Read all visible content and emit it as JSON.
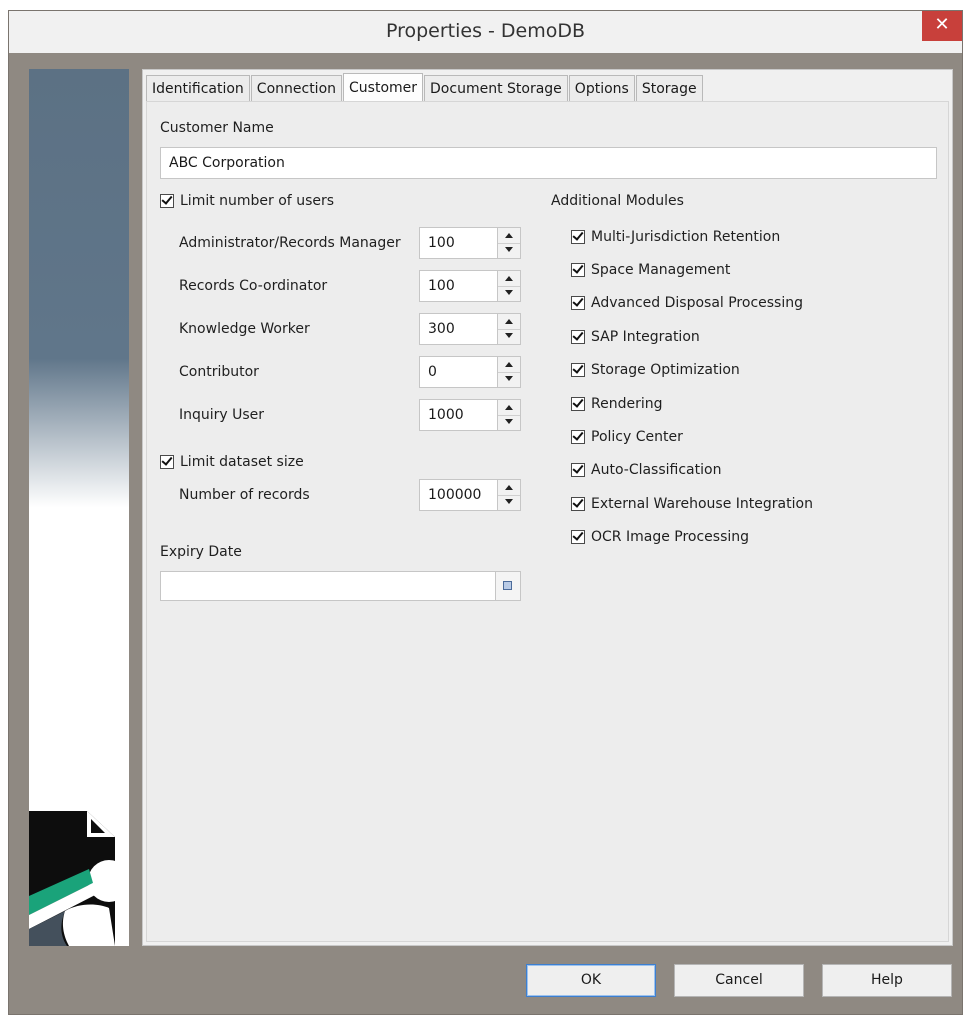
{
  "window": {
    "title": "Properties - DemoDB",
    "close_symbol": "✕"
  },
  "tabs": [
    {
      "label": "Identification"
    },
    {
      "label": "Connection"
    },
    {
      "label": "Customer",
      "active": true
    },
    {
      "label": "Document Storage"
    },
    {
      "label": "Options"
    },
    {
      "label": "Storage"
    }
  ],
  "customer": {
    "name_label": "Customer Name",
    "name_value": "ABC Corporation",
    "limit_users": {
      "label": "Limit number of users",
      "checked": true
    },
    "user_types": [
      {
        "label": "Administrator/Records Manager",
        "value": "100"
      },
      {
        "label": "Records Co-ordinator",
        "value": "100"
      },
      {
        "label": "Knowledge Worker",
        "value": "300"
      },
      {
        "label": "Contributor",
        "value": "0"
      },
      {
        "label": "Inquiry User",
        "value": "1000"
      }
    ],
    "limit_dataset": {
      "label": "Limit dataset size",
      "checked": true
    },
    "records": {
      "label": "Number of records",
      "value": "100000"
    },
    "expiry": {
      "label": "Expiry Date",
      "value": ""
    }
  },
  "modules": {
    "label": "Additional Modules",
    "items": [
      {
        "label": "Multi-Jurisdiction Retention",
        "checked": true
      },
      {
        "label": "Space Management",
        "checked": true
      },
      {
        "label": "Advanced Disposal Processing",
        "checked": true
      },
      {
        "label": "SAP Integration",
        "checked": true
      },
      {
        "label": "Storage Optimization",
        "checked": true
      },
      {
        "label": "Rendering",
        "checked": true
      },
      {
        "label": "Policy Center",
        "checked": true
      },
      {
        "label": "Auto-Classification",
        "checked": true
      },
      {
        "label": "External Warehouse Integration",
        "checked": true
      },
      {
        "label": "OCR Image Processing",
        "checked": true
      }
    ]
  },
  "buttons": {
    "ok": "OK",
    "cancel": "Cancel",
    "help": "Help"
  },
  "colors": {
    "accent_close": "#c8403b",
    "sidebar_blue": "#5c7184",
    "logo_green": "#1aa37a"
  }
}
